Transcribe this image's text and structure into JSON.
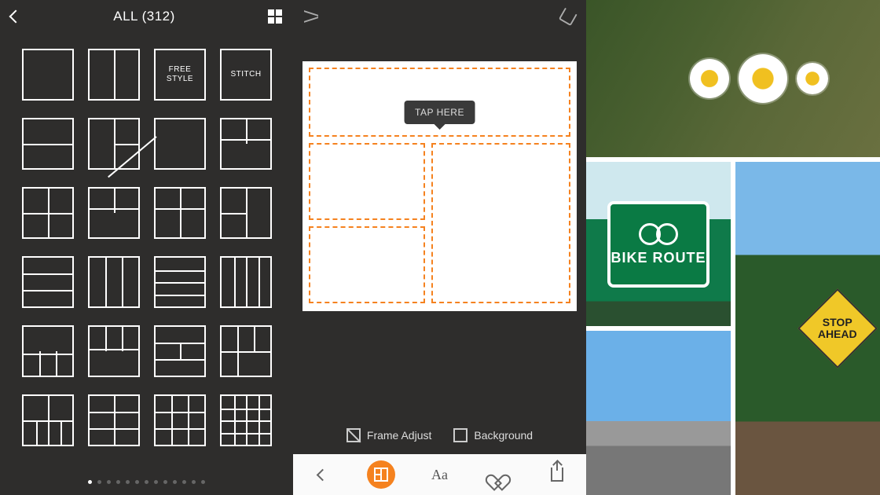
{
  "panel1": {
    "title": "ALL (312)",
    "templates": [
      {
        "text": "",
        "lines": []
      },
      {
        "text": "",
        "lines": [
          {
            "t": "v",
            "p": 50
          }
        ]
      },
      {
        "text": "FREE STYLE",
        "lines": []
      },
      {
        "text": "STITCH",
        "lines": []
      },
      {
        "text": "",
        "lines": [
          {
            "t": "h",
            "p": 50
          }
        ]
      },
      {
        "text": "",
        "lines": [
          {
            "t": "v",
            "p": 50
          },
          {
            "t": "h",
            "p": 50,
            "half": "r"
          }
        ]
      },
      {
        "text": "",
        "lines": [
          {
            "t": "d",
            "x": 0,
            "y": 35,
            "len": 80,
            "a": 50
          }
        ]
      },
      {
        "text": "",
        "lines": [
          {
            "t": "v",
            "p": 50,
            "half": "t"
          },
          {
            "t": "h",
            "p": 40
          }
        ]
      },
      {
        "text": "",
        "lines": [
          {
            "t": "h",
            "p": 50
          },
          {
            "t": "v",
            "p": 50
          }
        ]
      },
      {
        "text": "",
        "lines": [
          {
            "t": "h",
            "p": 40
          },
          {
            "t": "v",
            "p": 50,
            "half": "t"
          }
        ]
      },
      {
        "text": "",
        "lines": [
          {
            "t": "h",
            "p": 40
          },
          {
            "t": "v",
            "p": 50,
            "half": "b"
          },
          {
            "t": "v",
            "p": 50,
            "half": "t"
          }
        ]
      },
      {
        "text": "",
        "lines": [
          {
            "t": "v",
            "p": 50
          },
          {
            "t": "h",
            "p": 50,
            "half": "l"
          }
        ]
      },
      {
        "text": "",
        "lines": [
          {
            "t": "h",
            "p": 33
          },
          {
            "t": "h",
            "p": 66
          }
        ]
      },
      {
        "text": "",
        "lines": [
          {
            "t": "v",
            "p": 33
          },
          {
            "t": "v",
            "p": 66
          }
        ]
      },
      {
        "text": "",
        "lines": [
          {
            "t": "h",
            "p": 25
          },
          {
            "t": "h",
            "p": 50
          },
          {
            "t": "h",
            "p": 75
          }
        ]
      },
      {
        "text": "",
        "lines": [
          {
            "t": "v",
            "p": 25
          },
          {
            "t": "v",
            "p": 50
          },
          {
            "t": "v",
            "p": 75
          }
        ]
      },
      {
        "text": "",
        "lines": [
          {
            "t": "h",
            "p": 55
          },
          {
            "t": "v",
            "p": 33,
            "half": "b"
          },
          {
            "t": "v",
            "p": 66,
            "half": "b"
          }
        ]
      },
      {
        "text": "",
        "lines": [
          {
            "t": "h",
            "p": 45
          },
          {
            "t": "v",
            "p": 33,
            "half": "t"
          },
          {
            "t": "v",
            "p": 66,
            "half": "t"
          }
        ]
      },
      {
        "text": "",
        "lines": [
          {
            "t": "h",
            "p": 33
          },
          {
            "t": "h",
            "p": 66
          },
          {
            "t": "v",
            "p": 50,
            "seg": "m"
          }
        ]
      },
      {
        "text": "",
        "lines": [
          {
            "t": "h",
            "p": 50
          },
          {
            "t": "v",
            "p": 33
          },
          {
            "t": "v",
            "p": 66,
            "half": "t"
          }
        ]
      },
      {
        "text": "",
        "lines": [
          {
            "t": "h",
            "p": 50
          },
          {
            "t": "v",
            "p": 50
          },
          {
            "t": "v",
            "p": 25,
            "half": "b"
          },
          {
            "t": "v",
            "p": 75,
            "half": "b"
          }
        ]
      },
      {
        "text": "",
        "lines": [
          {
            "t": "h",
            "p": 33
          },
          {
            "t": "h",
            "p": 66
          },
          {
            "t": "v",
            "p": 50
          }
        ]
      },
      {
        "text": "",
        "lines": [
          {
            "t": "h",
            "p": 33
          },
          {
            "t": "h",
            "p": 66
          },
          {
            "t": "v",
            "p": 33
          },
          {
            "t": "v",
            "p": 66
          }
        ]
      },
      {
        "text": "",
        "lines": [
          {
            "t": "h",
            "p": 25
          },
          {
            "t": "h",
            "p": 50
          },
          {
            "t": "h",
            "p": 75
          },
          {
            "t": "v",
            "p": 25
          },
          {
            "t": "v",
            "p": 50
          },
          {
            "t": "v",
            "p": 75
          }
        ]
      }
    ],
    "dot_count": 13,
    "active_dot": 0
  },
  "panel2": {
    "tooltip": "TAP HERE",
    "frame_adjust": "Frame Adjust",
    "background": "Background",
    "text_button": "Aa"
  },
  "panel3": {
    "bike_route": "BIKE ROUTE",
    "stop_ahead": "STOP AHEAD"
  }
}
